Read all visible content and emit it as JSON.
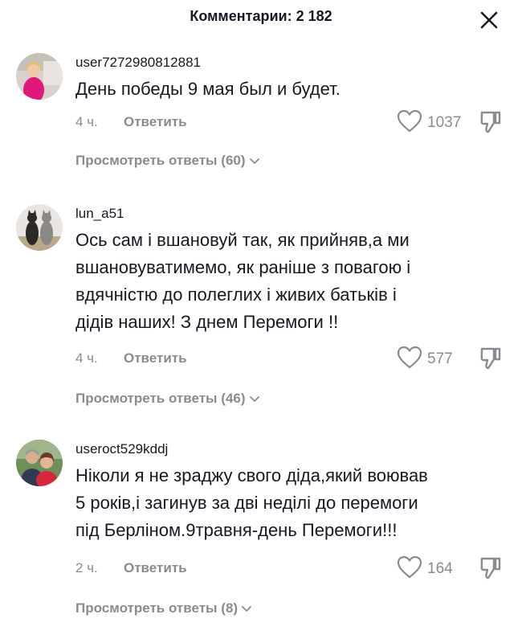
{
  "header": {
    "title": "Комментарии: 2 182",
    "close_icon": "close-icon"
  },
  "comments": [
    {
      "username": "user7272980812881",
      "text": "День победы 9 мая был и будет.",
      "time": "4 ч.",
      "reply_label": "Ответить",
      "likes": "1037",
      "view_replies": "Просмотреть ответы (60)"
    },
    {
      "username": "lun_a51",
      "text": "Ось сам і вшановуй так, як прийняв,а ми\nвшановуватимемо, як раніше з повагою і\nвдячністю до полеглих і живих батьків і\nдідів наших! З днем Перемоги !!",
      "time": "4 ч.",
      "reply_label": "Ответить",
      "likes": "577",
      "view_replies": "Просмотреть ответы (46)"
    },
    {
      "username": "useroct529kddj",
      "text": "Ніколи я не зраджу свого діда,який воював\n5 років,і загинув за дві неділі до перемоги\nпід Берліном.9травня-день Перемоги!!!",
      "time": "2 ч.",
      "reply_label": "Ответить",
      "likes": "164",
      "view_replies": "Просмотреть ответы (8)"
    }
  ],
  "colors": {
    "text_primary": "#161823",
    "text_secondary": "#8a8b91"
  }
}
